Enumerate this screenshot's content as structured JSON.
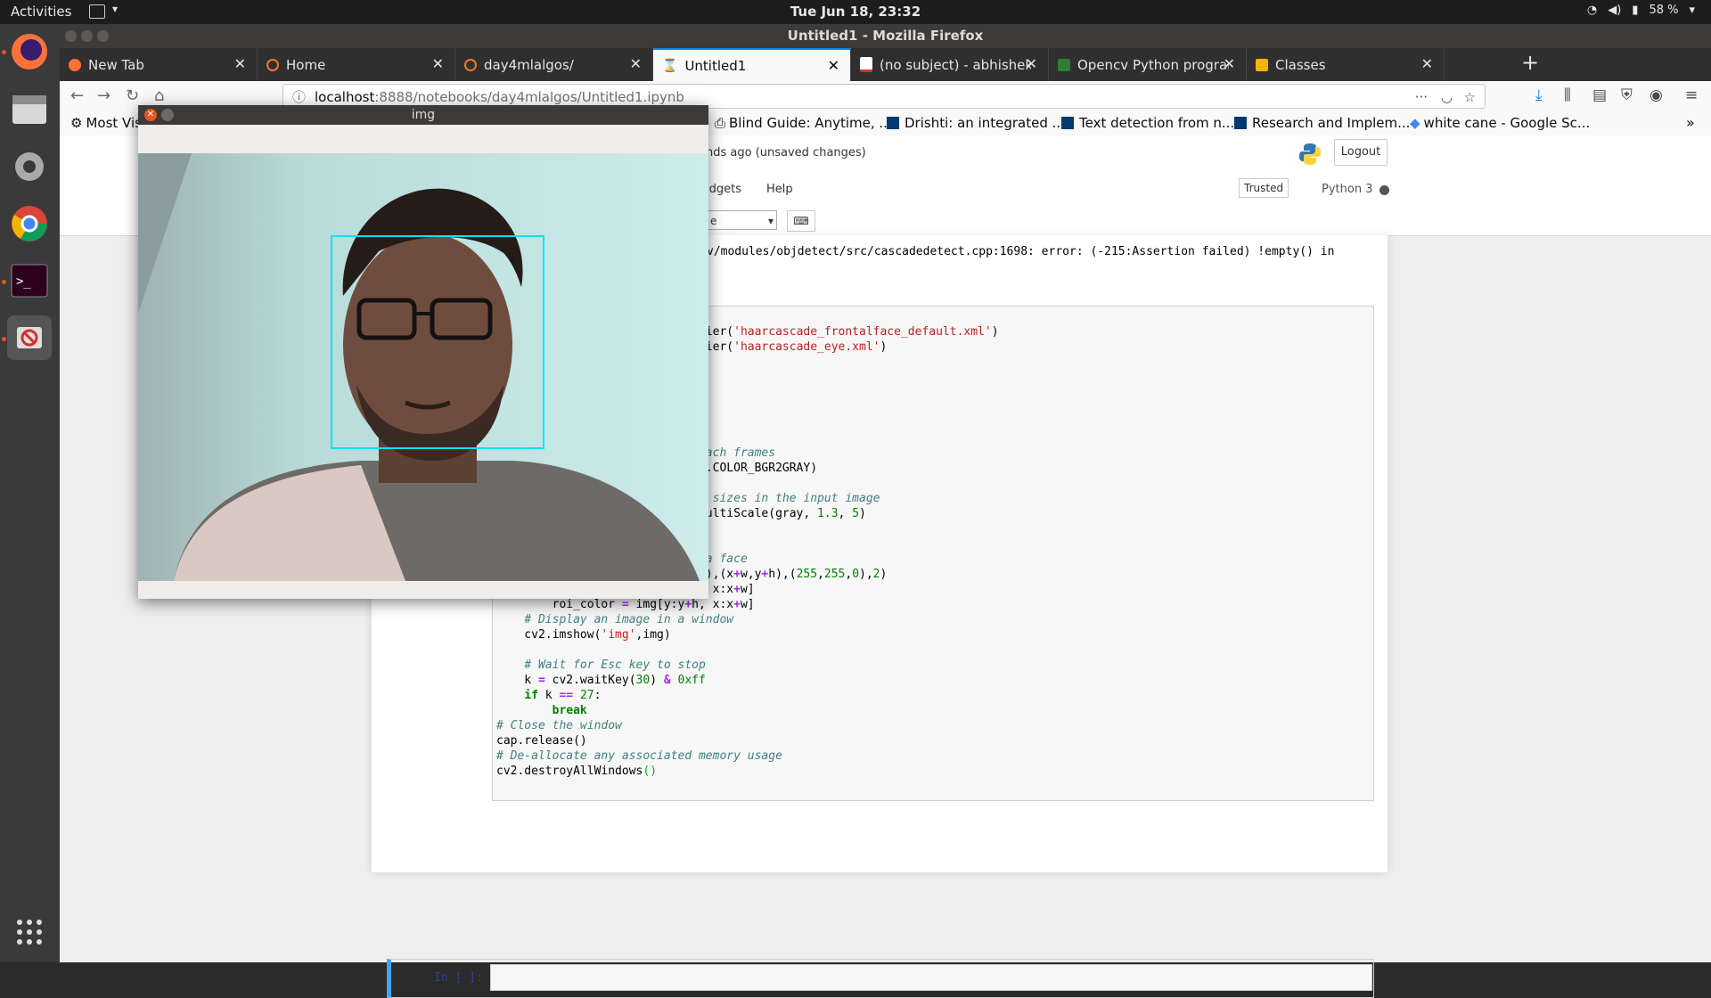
{
  "topbar": {
    "activities": "Activities",
    "clock": "Tue Jun 18, 23:32",
    "battery": "58 %"
  },
  "window": {
    "title": "Untitled1 - Mozilla Firefox"
  },
  "tabs": [
    {
      "title": "New Tab",
      "favicon_color": "#ff7139"
    },
    {
      "title": "Home",
      "favicon_color": "#f37726"
    },
    {
      "title": "day4mlalgos/",
      "favicon_color": "#f37726"
    },
    {
      "title": "Untitled1",
      "favicon_color": "#f37726",
      "active": true
    },
    {
      "title": "(no subject) - abhishek.c",
      "favicon_color": "#d93025"
    },
    {
      "title": "Opencv Python program",
      "favicon_color": "#2e7d32"
    },
    {
      "title": "Classes",
      "favicon_color": "#f4b400"
    }
  ],
  "url": {
    "host": "localhost",
    "rest": ":8888/notebooks/day4mlalgos/Untitled1.ipynb"
  },
  "bookmarks": [
    {
      "label": "Most Vis",
      "icon": "gear-icon"
    },
    {
      "label": "Blind Guide: Anytime, ...",
      "icon": "page-icon"
    },
    {
      "label": "Drishti: an integrated ...",
      "icon": "ieee-icon"
    },
    {
      "label": "Text detection from n...",
      "icon": "ieee-icon"
    },
    {
      "label": "Research and Implem...",
      "icon": "ieee-icon"
    },
    {
      "label": "white cane - Google Sc...",
      "icon": "scholar-icon"
    }
  ],
  "jupyter": {
    "save_status": "nds ago  (unsaved changes)",
    "logout": "Logout",
    "menu_widgets": "idgets",
    "menu_help": "Help",
    "trusted": "Trusted",
    "kernel": "Python 3",
    "celltype": "e",
    "error_line": "v/modules/objdetect/src/cascadedetect.cpp:1698: error: (-215:Assertion failed) !empty() in",
    "empty_prompt": "In [ ]:"
  },
  "imgwin": {
    "title": "img"
  },
  "colors": {
    "accent": "#0a84ff",
    "jupyter_orange": "#f37726",
    "box": "#00e5ef"
  }
}
